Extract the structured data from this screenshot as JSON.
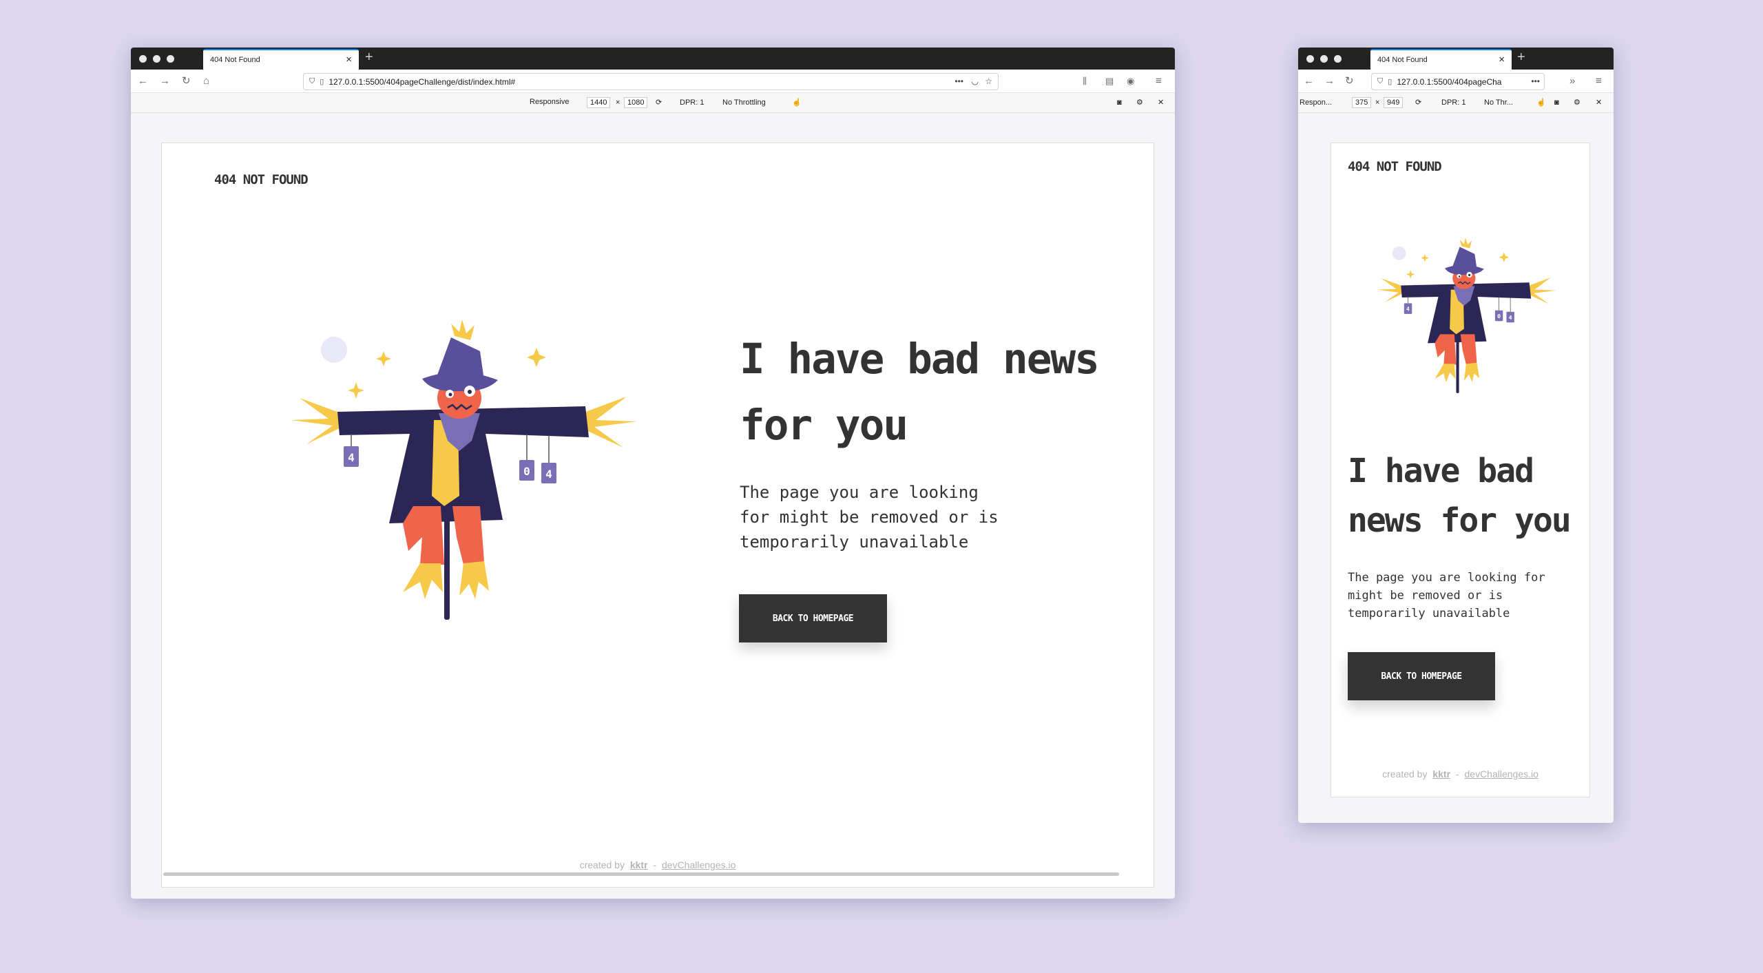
{
  "desktop": {
    "tab_title": "404 Not Found",
    "url": "127.0.0.1:5500/404pageChallenge/dist/index.html#",
    "rdm": {
      "mode": "Responsive",
      "width": "1440",
      "times": "×",
      "height": "1080",
      "dpr": "DPR: 1",
      "throttle": "No Throttling"
    },
    "page": {
      "brand": "404 NOT FOUND",
      "headline": "I have bad news for you",
      "description": "The page you are looking for might be removed or is temporarily unavailable",
      "cta": "BACK TO HOMEPAGE",
      "footer_prefix": "created by",
      "footer_author": "kktr",
      "footer_sep": "-",
      "footer_site": "devChallenges.io"
    }
  },
  "mobile": {
    "tab_title": "404 Not Found",
    "url": "127.0.0.1:5500/404pageCha",
    "rdm": {
      "mode": "Respon...",
      "width": "375",
      "times": "×",
      "height": "949",
      "dpr": "DPR: 1",
      "throttle": "No Thr..."
    },
    "page": {
      "brand": "404 NOT FOUND",
      "headline": "I have bad news for you",
      "description": "The page you are looking for might be removed or is temporarily unavailable",
      "cta": "BACK TO HOMEPAGE",
      "footer_prefix": "created by",
      "footer_author": "kktr",
      "footer_sep": "-",
      "footer_site": "devChallenges.io"
    }
  },
  "illustration": {
    "can_labels": [
      "4",
      "0",
      "4"
    ]
  },
  "colors": {
    "desktop_bg": "#dcd7ef",
    "text": "#333333",
    "button": "#333333",
    "hat": "#5a4f9b",
    "coat": "#2b2653",
    "face": "#f06449",
    "straw": "#f7c948",
    "footer": "#b3b3b3"
  }
}
